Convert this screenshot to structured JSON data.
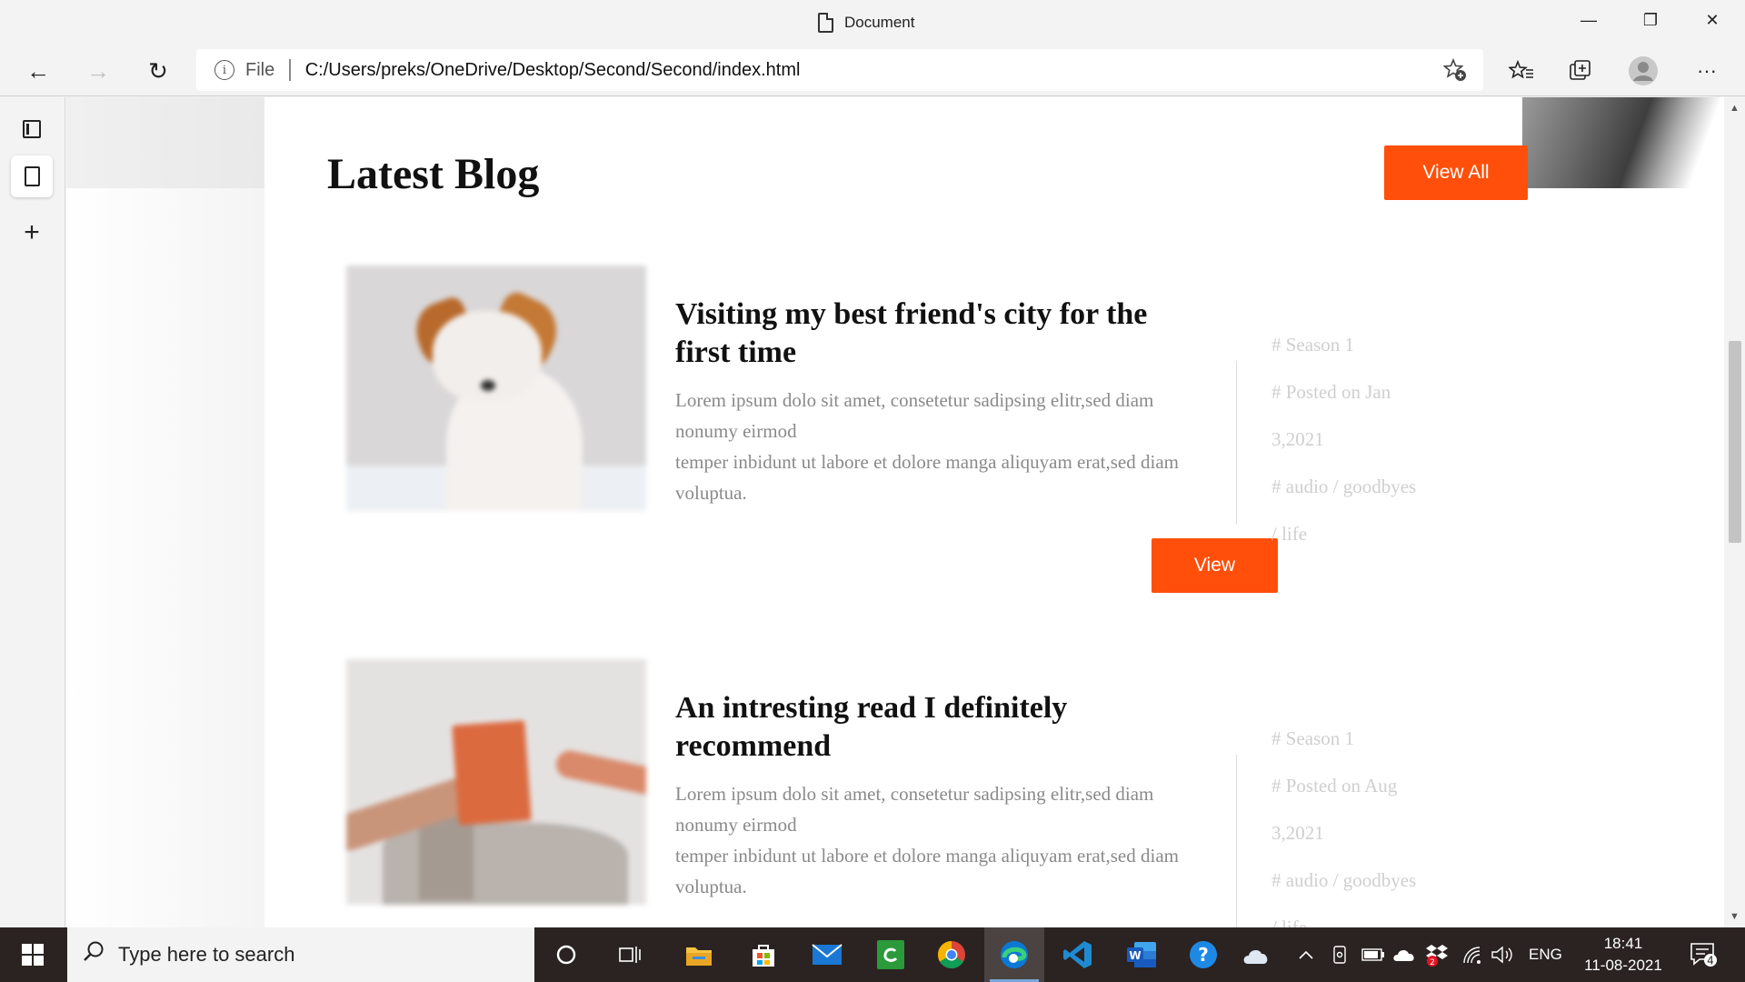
{
  "window": {
    "title": "Document",
    "controls": {
      "minimize": "—",
      "restore": "❐",
      "close": "✕"
    }
  },
  "toolbar": {
    "back": "←",
    "forward": "→",
    "refresh": "↻",
    "address_scheme": "File",
    "address_url": "C:/Users/preks/OneDrive/Desktop/Second/Second/index.html",
    "favorites": "☆",
    "more": "···"
  },
  "sidebar": {
    "new_tab": "+"
  },
  "page": {
    "heading": "Latest Blog",
    "view_all": "View All",
    "posts": [
      {
        "title": "Visiting my best friend's city for the first time",
        "body_line1": "Lorem ipsum dolo sit amet, consetetur sadipsing elitr,sed diam nonumy eirmod",
        "body_line2": "temper inbidunt ut labore et dolore manga aliquyam erat,sed diam voluptua.",
        "button": "View",
        "tags": [
          "# Season 1",
          "# Posted on Jan",
          "3,2021",
          "# audio / goodbyes",
          "/ life"
        ]
      },
      {
        "title": "An intresting read I definitely recommend",
        "body_line1": "Lorem ipsum dolo sit amet, consetetur sadipsing elitr,sed diam nonumy eirmod",
        "body_line2": "temper inbidunt ut labore et dolore manga aliquyam erat,sed diam voluptua.",
        "tags": [
          "# Season 1",
          "# Posted on Aug",
          "3,2021",
          "# audio / goodbyes",
          "/ life"
        ]
      }
    ]
  },
  "taskbar": {
    "search_placeholder": "Type here to search",
    "language": "ENG",
    "time": "18:41",
    "date": "11-08-2021",
    "notification_count": "4",
    "dropbox_badge": "2"
  },
  "colors": {
    "accent": "#ff4f0a",
    "tag_text": "#cfcfcf",
    "body_text": "#8a8a8a"
  }
}
